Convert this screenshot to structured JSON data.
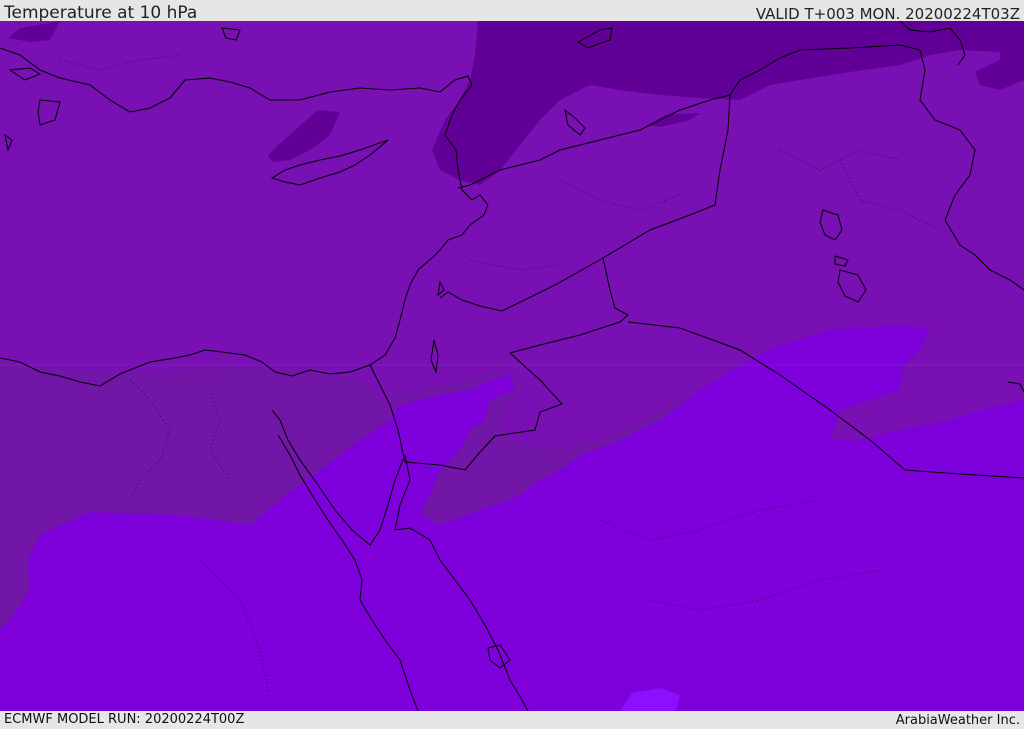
{
  "header": {
    "title": "Temperature at 10 hPa",
    "valid": "VALID T+003 MON. 20200224T03Z"
  },
  "footer": {
    "model_run": "ECMWF MODEL RUN: 20200224T00Z",
    "credit": "ArabiaWeather Inc."
  },
  "map": {
    "field": "temperature",
    "level": "10 hPa",
    "colors": {
      "dark_band": "#610096",
      "mid_band": "#7810b3",
      "southwest_band": "#7116a7",
      "light_band": "#7e00db",
      "lightest_spot": "#8a10ff",
      "boundaries": "#000000"
    }
  }
}
